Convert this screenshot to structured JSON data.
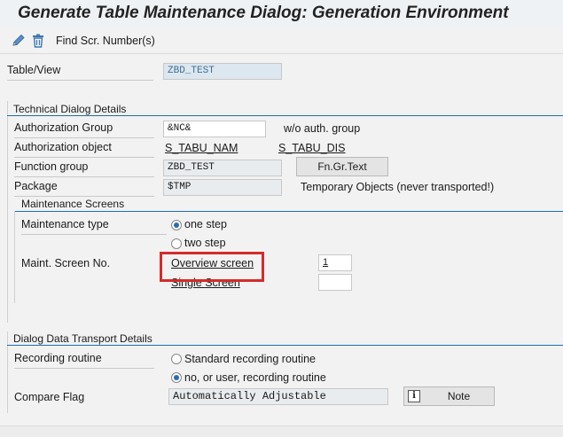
{
  "window": {
    "title": "Generate Table Maintenance Dialog: Generation Environment"
  },
  "toolbar": {
    "icons": [
      "pencil-icon",
      "trash-icon"
    ],
    "find_screen_numbers": "Find Scr. Number(s)"
  },
  "table_view": {
    "label": "Table/View",
    "value": "ZBD_TEST"
  },
  "technical": {
    "title": "Technical Dialog Details",
    "auth_group_label": "Authorization Group",
    "auth_group_value": "&NC&",
    "auth_group_desc": "w/o auth. group",
    "auth_object_label": "Authorization object",
    "auth_object_value": "S_TABU_NAM",
    "auth_object_value2": "S_TABU_DIS",
    "function_group_label": "Function group",
    "function_group_value": "ZBD_TEST",
    "fn_gr_text_button": "Fn.Gr.Text",
    "package_label": "Package",
    "package_value": "$TMP",
    "package_desc": "Temporary Objects (never transported!)"
  },
  "maintenance": {
    "title": "Maintenance Screens",
    "type_label": "Maintenance type",
    "one_step": "one step",
    "two_step": "two step",
    "selected": "one step",
    "screen_no_label": "Maint. Screen No.",
    "overview_link": "Overview screen",
    "overview_value": "1",
    "single_link": "Single Screen",
    "single_value": ""
  },
  "transport": {
    "title": "Dialog Data Transport Details",
    "recording_label": "Recording routine",
    "standard_option": "Standard recording routine",
    "user_option": "no, or user, recording routine",
    "selected": "no, or user, recording routine",
    "compare_label": "Compare Flag",
    "compare_value": "Automatically Adjustable",
    "note_button": "Note"
  },
  "colors": {
    "accent": "#1f6db4",
    "highlight": "#d52b2b"
  }
}
